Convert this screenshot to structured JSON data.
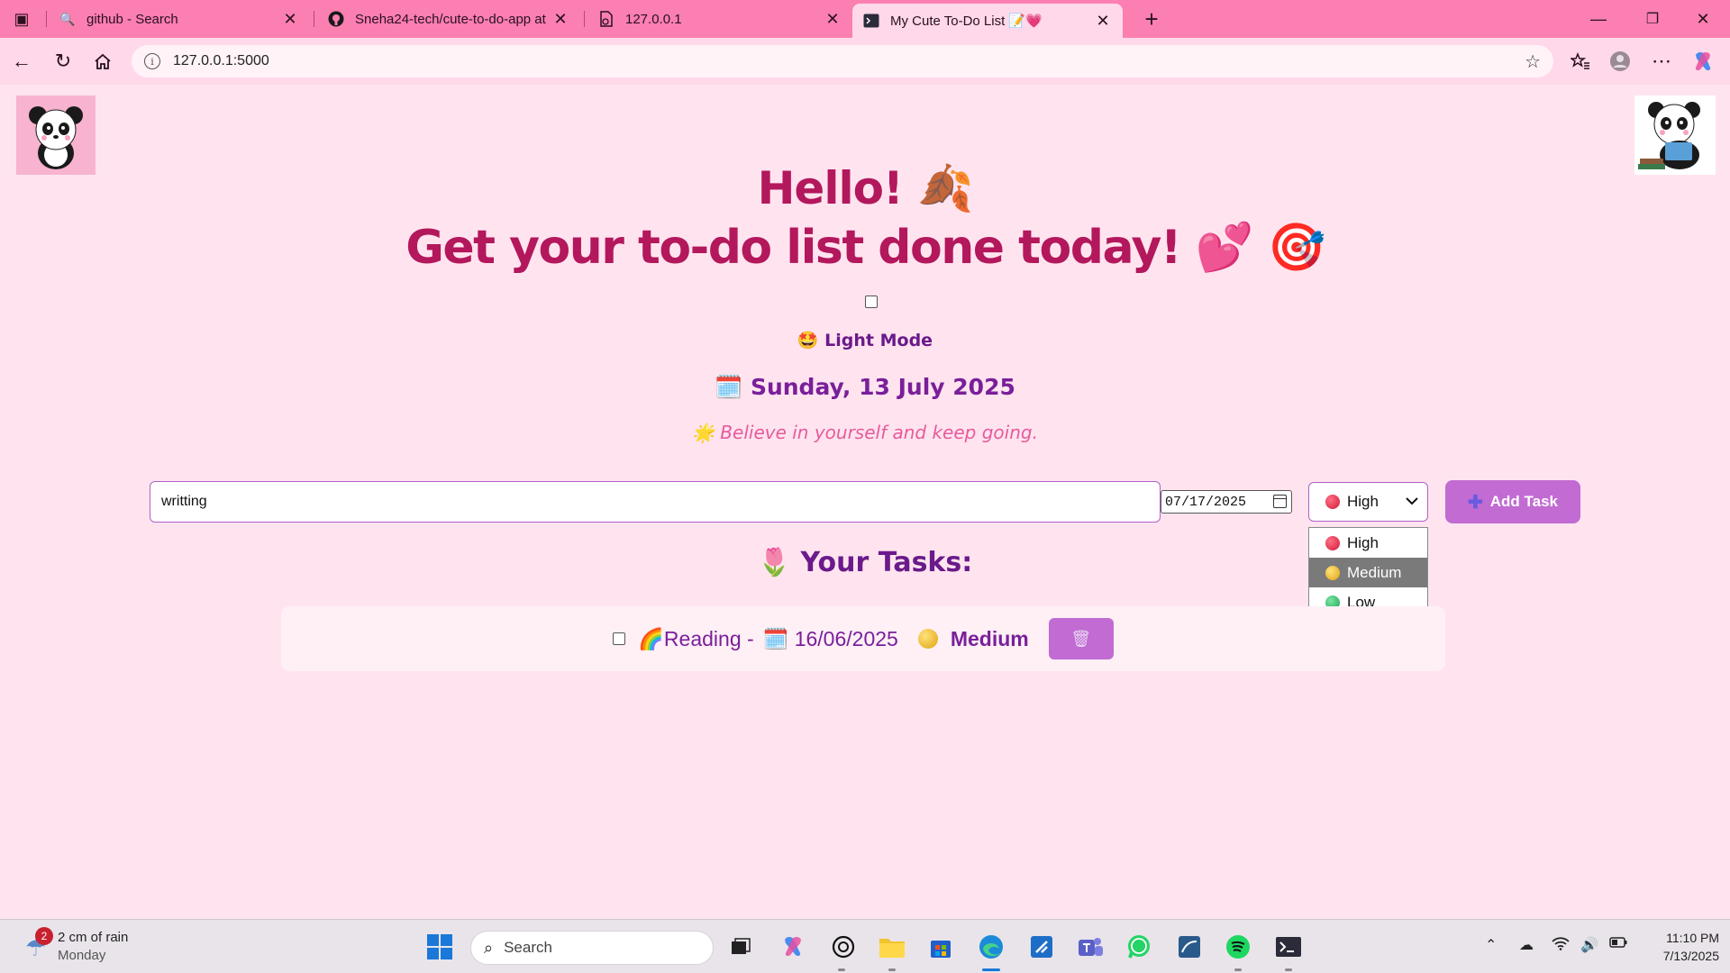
{
  "browser": {
    "tabs": [
      {
        "title": "github - Search",
        "favicon": "search-icon"
      },
      {
        "title": "Sneha24-tech/cute-to-do-app at",
        "favicon": "github-icon"
      },
      {
        "title": "127.0.0.1",
        "favicon": "page-icon"
      },
      {
        "title": "My Cute To-Do List 📝💗",
        "favicon": "terminal-icon"
      }
    ],
    "new_tab_label": "+",
    "url": "127.0.0.1:5000"
  },
  "page": {
    "hello": "Hello! 🍂",
    "subhead": "Get your to-do list done today! 💕 🎯",
    "mode_label": "🤩 Light Mode",
    "date_line": "🗓️ Sunday, 13 July 2025",
    "quote": "🌟 Believe in yourself and keep going.",
    "task_input_value": "writting",
    "date_input_value": "07/17/2025",
    "priority_selected": "High",
    "priority_options": [
      "High",
      "Medium",
      "Low"
    ],
    "add_button_label": "Add Task",
    "tasks_title": "🌷 Your Tasks:",
    "tasks": [
      {
        "name": "🌈Reading -",
        "date": "🗓️ 16/06/2025",
        "priority": "Medium",
        "delete_icon": "🗑"
      }
    ]
  },
  "taskbar": {
    "weather_badge": "2",
    "weather_line1": "2 cm of rain",
    "weather_line2": "Monday",
    "search_placeholder": "Search",
    "time": "11:10 PM",
    "date": "7/13/2025"
  },
  "colors": {
    "tabbar": "#fb7fb1",
    "page_bg": "#ffe4ef",
    "heading": "#b3175c",
    "accent_purple": "#c16bd3",
    "text_purple": "#7a1f9a"
  }
}
